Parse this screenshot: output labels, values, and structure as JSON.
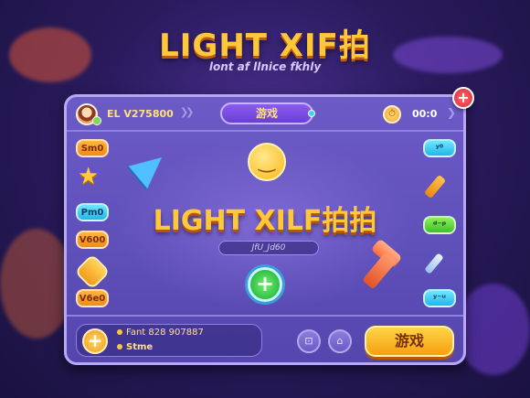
{
  "title": "LIGHT XIF拍",
  "subtitle": "lont af llnice fkhly",
  "header": {
    "player_id": "EL V275800",
    "game_tab": "游戏",
    "timer": "00:0"
  },
  "left_buttons": [
    "Sm0",
    "Pm0",
    "V600",
    "V6e0"
  ],
  "right_buttons": [
    "ʸ⁰",
    "ᵈ⁻ᵖ",
    "ʸ⁻ᵘ"
  ],
  "main_heading": "LIGHT XILF拍拍",
  "heading_sub": "JfU_Jd60",
  "footer": {
    "line1": "Fant 828 907887",
    "line2": "Stme",
    "play_label": "游戏"
  },
  "colors": {
    "accent": "#ffc83a",
    "panel": "#6c5bc7",
    "background": "#2a1b5e"
  }
}
